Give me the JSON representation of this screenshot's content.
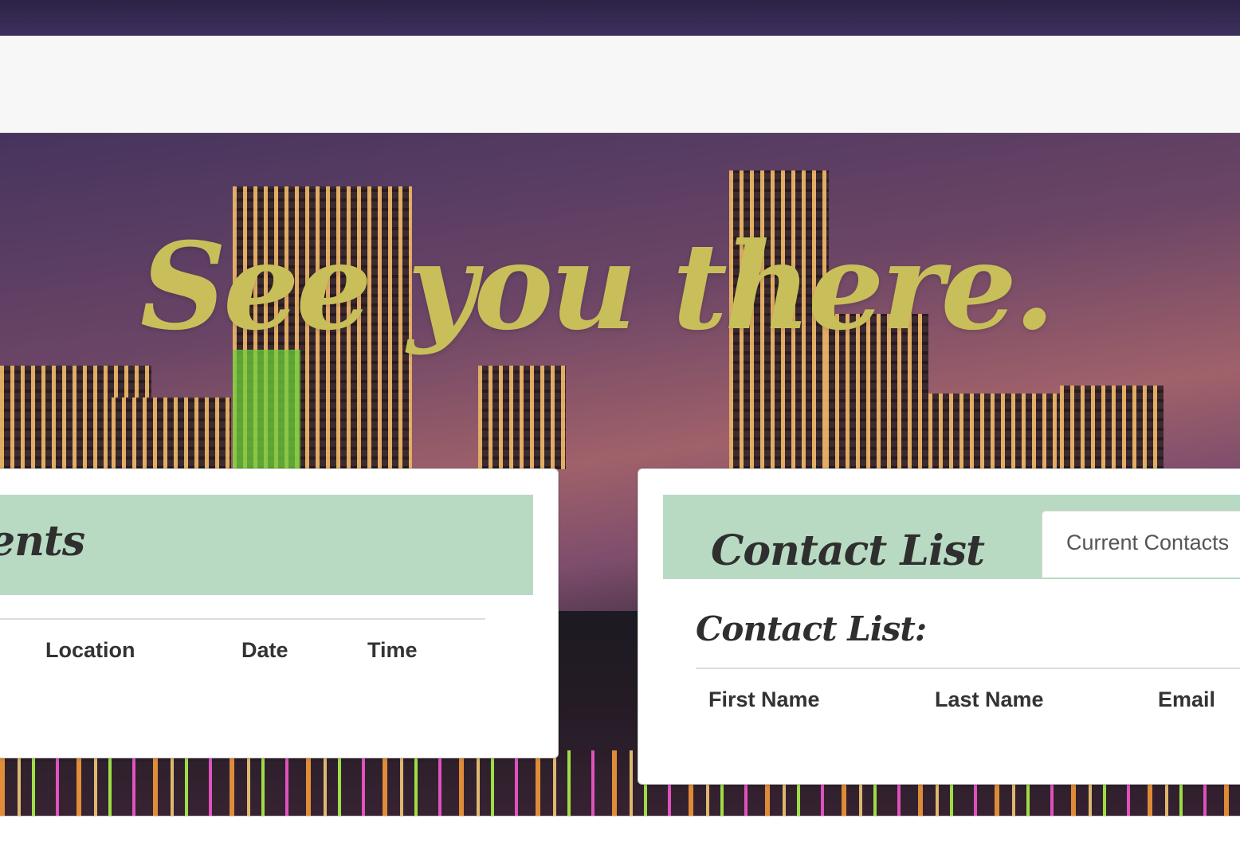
{
  "hero": {
    "title": "See you there."
  },
  "events_panel": {
    "title": "ents",
    "columns": [
      "Location",
      "Date",
      "Time"
    ]
  },
  "contacts_panel": {
    "title": "Contact List",
    "tab_label": "Current Contacts",
    "subtitle": "Contact List:",
    "columns": [
      "First Name",
      "Last Name",
      "Email"
    ]
  },
  "colors": {
    "panel_header": "#b8dac3",
    "hero_title": "#c9bf5a",
    "navbar_bg": "#f7f7f7",
    "top_strip": "#3d2f5c"
  }
}
